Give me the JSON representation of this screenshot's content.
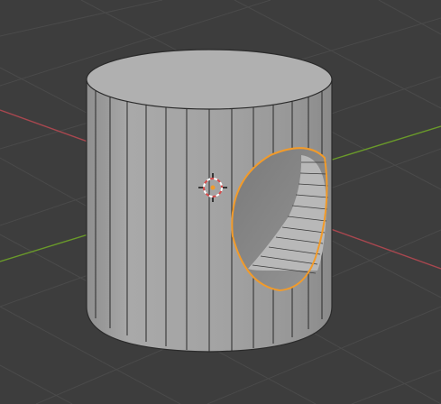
{
  "viewport": {
    "background": "#3d3d3d",
    "grid_color": "#4a4a4a",
    "x_axis_color": "#a8474f",
    "y_axis_color": "#6a9a2a"
  },
  "object": {
    "type": "cylinder",
    "surface_color": "#a6a6a6",
    "cap_color": "#b0b0b0",
    "edge_color": "#2a2a2a",
    "selection_color": "#f29b2a"
  },
  "gizmo": {
    "icon": "3d-cursor-icon",
    "ring_color_a": "#d84a4a",
    "ring_color_b": "#ffffff"
  }
}
